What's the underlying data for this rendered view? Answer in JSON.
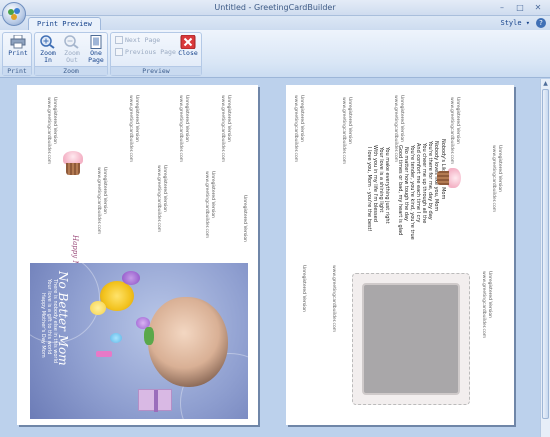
{
  "window": {
    "title": "Untitled - GreetingCardBuilder"
  },
  "tabs": {
    "active": "Print Preview",
    "style_menu": "Style ▾"
  },
  "ribbon": {
    "groups": {
      "print": "Print",
      "zoom": "Zoom",
      "preview": "Preview"
    },
    "print_label": "Print",
    "zoom_in_line1": "Zoom",
    "zoom_in_line2": "In",
    "zoom_out_line1": "Zoom",
    "zoom_out_line2": "Out",
    "one_page_line1": "One",
    "one_page_line2": "Page",
    "next_page": "Next Page",
    "previous_page": "Previous Page",
    "close_label": "Close"
  },
  "card": {
    "unregistered": "Unregistered Version",
    "site": "www.greetingcardbuilder.com",
    "title_script": "No Better Mom",
    "happy_script": "Happy Mother's Day",
    "poem": [
      "Nobody's Like You, Mom",
      "Nobody loves like you, Mom",
      "You're there for me, day by day",
      "You cheer me up through all the",
      "And comfort me each time I cry",
      "You're tender, you're kind, you're true",
      "No matter how tough the day",
      "Good times or bad, my heart is glad",
      "You make everything just right",
      "Your love is a shining light",
      "With you in my life I'm blessed",
      "I love you, Mom - you're the best!"
    ],
    "caption": [
      "There is nobody else in this world",
      "Your love is a gift to this world",
      "Happy Mother's Day Mom"
    ]
  },
  "colors": {
    "ribbon_text": "#15428b",
    "workspace": "#bcd1ec",
    "close_red": "#d9393b"
  }
}
